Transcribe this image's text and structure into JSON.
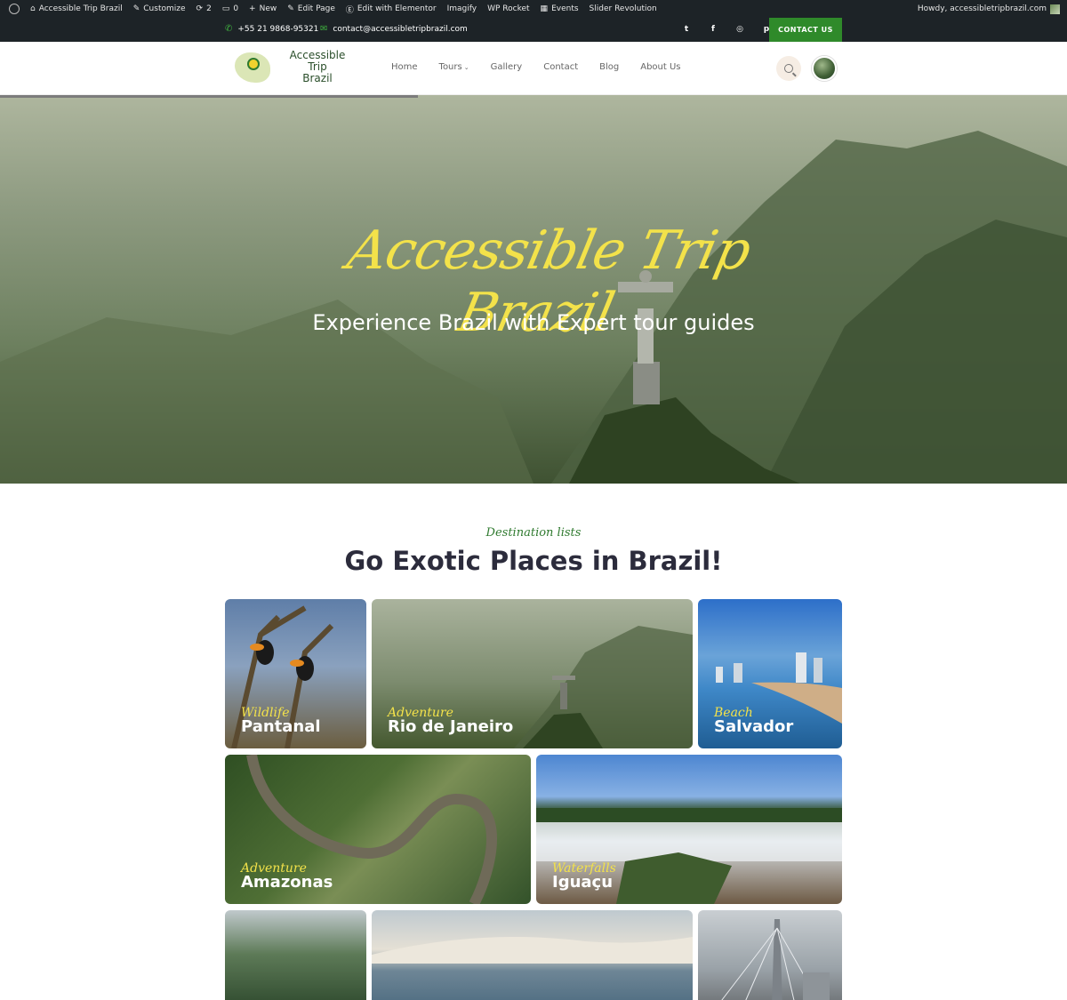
{
  "admin_bar": {
    "site_name": "Accessible Trip Brazil",
    "customize": "Customize",
    "updates_count": "2",
    "comments_count": "0",
    "new": "New",
    "edit_page": "Edit Page",
    "edit_elementor": "Edit with Elementor",
    "imagify": "Imagify",
    "wp_rocket": "WP Rocket",
    "events": "Events",
    "slider_revolution": "Slider Revolution",
    "howdy": "Howdy, accessibletripbrazil.com"
  },
  "topbar": {
    "phone": "+55 21 9868-95321",
    "email": "contact@accessibletripbrazil.com",
    "socials": [
      "twitter-icon",
      "facebook-icon",
      "instagram-icon",
      "pinterest-icon"
    ],
    "contact_button": "CONTACT US",
    "accent_color": "#2f8a2a"
  },
  "header": {
    "logo_line1": "Accessible Trip",
    "logo_line2": "Brazil",
    "nav": [
      "Home",
      "Tours",
      "Gallery",
      "Contact",
      "Blog",
      "About Us"
    ]
  },
  "hero": {
    "script_title": "Accessible Trip Brazil",
    "tagline": "Experience Brazil with Expert tour guides",
    "script_color": "#f3e24a"
  },
  "destinations": {
    "eyebrow": "Destination lists",
    "title": "Go Exotic Places in Brazil!",
    "cards": [
      {
        "category": "Wildlife",
        "name": "Pantanal"
      },
      {
        "category": "Adventure",
        "name": "Rio de Janeiro"
      },
      {
        "category": "Beach",
        "name": "Salvador"
      },
      {
        "category": "Adventure",
        "name": "Amazonas"
      },
      {
        "category": "Waterfalls",
        "name": "Iguaçu"
      }
    ]
  }
}
